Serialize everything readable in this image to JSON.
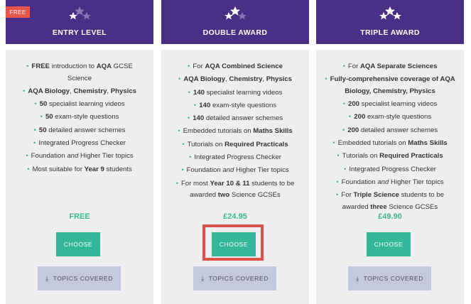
{
  "badge": "FREE",
  "colors": {
    "header_bg": "#4a2f86",
    "card_bg": "#efefef",
    "accent_green": "#3cb88f",
    "choose_btn": "#34b799",
    "topics_btn": "#c5c9de",
    "badge_red": "#e8534a",
    "highlight_red": "#d9534a"
  },
  "cards": [
    {
      "title": "ENTRY LEVEL",
      "features": [
        "• <b>FREE</b> introduction to <b>AQA</b> GCSE<br>Science",
        "• <b>AQA Biology</b>, <b>Chemistry</b>, <b>Physics</b>",
        "• <b>50</b> specialist learning videos",
        "• <b>50</b> exam-style questions",
        "• <b>50</b> detailed answer schemes",
        "• Integrated Progress Checker",
        "• Foundation <i>and</i> Higher Tier topics",
        "• Most suitable for <b>Year 9</b> students"
      ],
      "price": "FREE",
      "choose_label": "CHOOSE",
      "topics_label": "TOPICS COVERED"
    },
    {
      "title": "DOUBLE AWARD",
      "features": [
        "• For <b>AQA Combined Science</b>",
        "• <b>AQA Biology</b>, <b>Chemistry</b>, <b>Physics</b>",
        "• <b>140</b> specialist learning videos",
        "• <b>140</b> exam-style questions",
        "• <b>140</b> detailed answer schemes",
        "• Embedded tutorials on <b>Maths Skills</b>",
        "• Tutorials on <b>Required Practicals</b>",
        "• Integrated Progress Checker",
        "• Foundation <i>and</i> Higher Tier topics",
        "• For most <b>Year 10 &amp; 11</b> students to be<br>awarded <b>two</b> Science GCSEs"
      ],
      "price": "£24.95",
      "choose_label": "CHOOSE",
      "topics_label": "TOPICS COVERED"
    },
    {
      "title": "TRIPLE AWARD",
      "features": [
        "• For <b>AQA Separate Sciences</b>",
        "• <b>Fully-comprehensive coverage of AQA</b><br><b>Biology, Chemistry, Physics</b>",
        "• <b>200</b> specialist learning videos",
        "• <b>200</b> exam-style questions",
        "• <b>200</b> detailed answer schemes",
        "• Embedded tutorials on <b>Maths Skills</b>",
        "• Tutorials on <b>Required Practicals</b>",
        "• Integrated Progress Checker",
        "• Foundation <i>and</i> Higher Tier topics",
        "• For <b>Triple Science</b> students to be<br>awarded <b>three</b> Science GCSEs"
      ],
      "price": "£49.90",
      "choose_label": "CHOOSE",
      "topics_label": "TOPICS COVERED"
    }
  ]
}
